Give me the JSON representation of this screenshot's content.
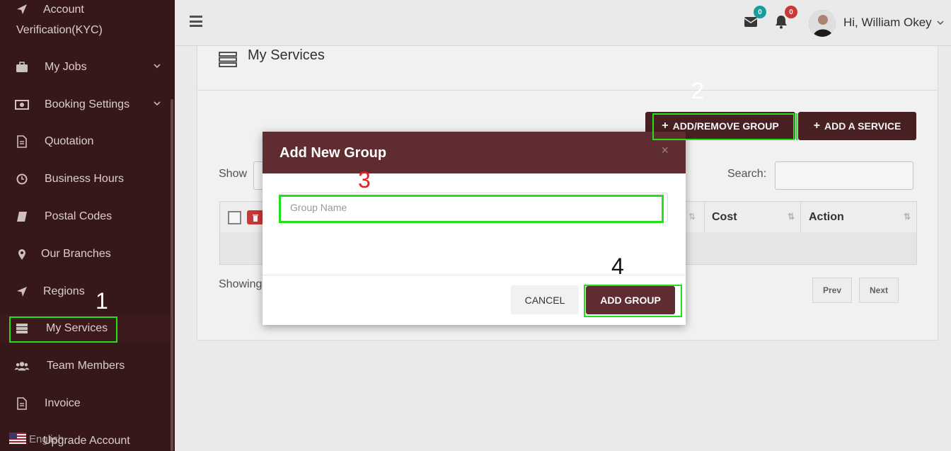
{
  "sidebar": {
    "items": [
      {
        "label": "Account",
        "label2": "Verification(KYC)",
        "icon": "paper-plane-icon"
      },
      {
        "label": "My Jobs",
        "icon": "briefcase-icon",
        "chevron": true
      },
      {
        "label": "Booking Settings",
        "icon": "money-icon",
        "chevron": true
      },
      {
        "label": "Quotation",
        "icon": "file-icon"
      },
      {
        "label": "Business Hours",
        "icon": "clock-icon"
      },
      {
        "label": "Postal Codes",
        "icon": "book-icon"
      },
      {
        "label": "Our Branches",
        "icon": "map-pin-icon"
      },
      {
        "label": "Regions",
        "icon": "location-arrow-icon"
      },
      {
        "label": "My Services",
        "icon": "server-icon",
        "active": true
      },
      {
        "label": "Team Members",
        "icon": "users-icon"
      },
      {
        "label": "Invoice",
        "icon": "file-icon"
      },
      {
        "label": "Upgrade Account",
        "icon": "upgrade-icon"
      }
    ],
    "language": "English"
  },
  "topbar": {
    "messages_count": "0",
    "notifications_count": "0",
    "greeting": "Hi, William Okey"
  },
  "main": {
    "title": "My Services",
    "add_remove_group": "ADD/REMOVE GROUP",
    "add_service": "ADD A SERVICE",
    "show_label": "Show",
    "search_label": "Search:",
    "columns": [
      "Cost",
      "Action"
    ],
    "showing_label": "Showing",
    "prev": "Prev",
    "next": "Next"
  },
  "modal": {
    "title": "Add New Group",
    "close": "×",
    "input_placeholder": "Group Name",
    "cancel": "CANCEL",
    "add_group": "ADD GROUP"
  },
  "annotations": [
    "1",
    "2",
    "3",
    "4"
  ],
  "colors": {
    "sidebar_bg": "#3a1a1c",
    "brand": "#5f2d2f",
    "highlight": "#22e01e",
    "badge_teal": "#1aa3a3",
    "badge_red": "#d23a3a"
  }
}
